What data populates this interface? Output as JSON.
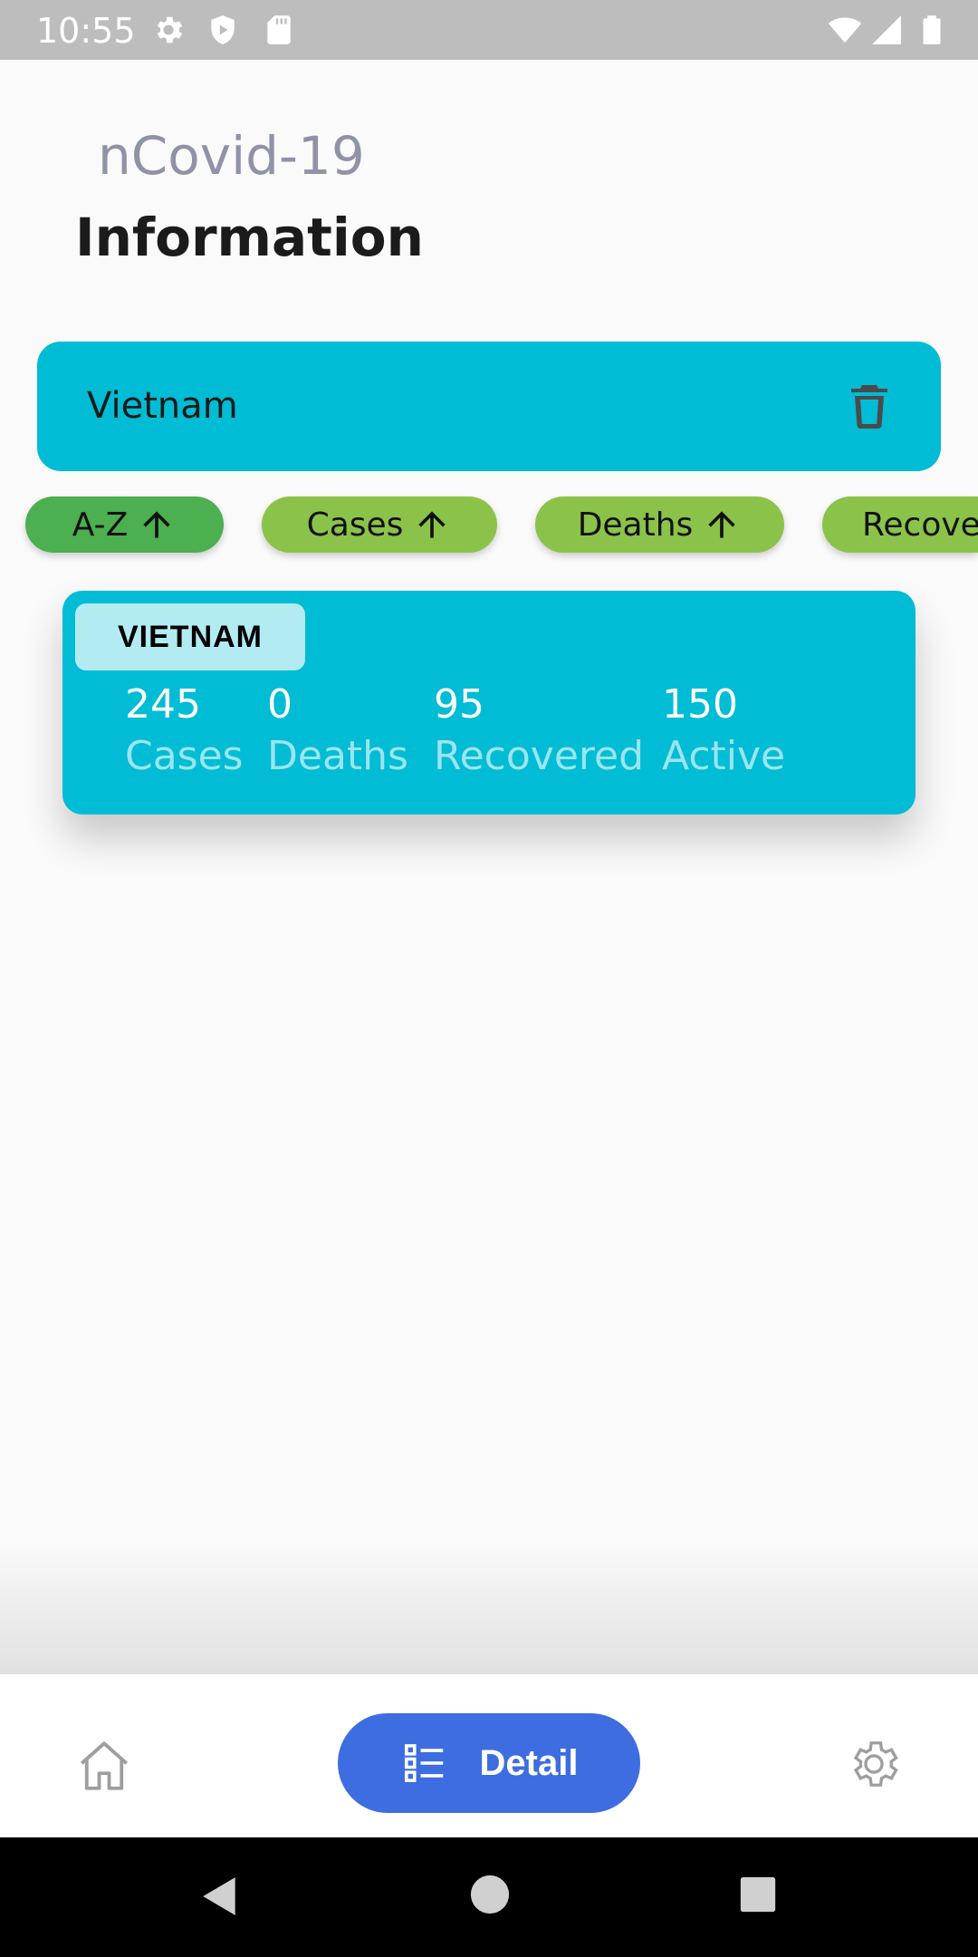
{
  "status_bar": {
    "time": "10:55",
    "icons": [
      "gear-icon",
      "shield-icon",
      "sd-card-icon",
      "wifi-icon",
      "signal-icon",
      "battery-icon"
    ]
  },
  "header": {
    "subtitle": "nCovid-19",
    "title": "Information"
  },
  "search": {
    "value": "Vietnam",
    "clear_icon": "delete-icon"
  },
  "sort_chips": [
    {
      "label": "A-Z",
      "icon": "arrow-up-icon",
      "active": true
    },
    {
      "label": "Cases",
      "icon": "arrow-up-icon",
      "active": false
    },
    {
      "label": "Deaths",
      "icon": "arrow-up-icon",
      "active": false
    },
    {
      "label": "Recove",
      "icon": "",
      "active": false
    }
  ],
  "country_card": {
    "country": "VIETNAM",
    "stats": [
      {
        "value": "245",
        "label": "Cases"
      },
      {
        "value": "0",
        "label": "Deaths"
      },
      {
        "value": "95",
        "label": "Recovered"
      },
      {
        "value": "150",
        "label": "Active"
      }
    ]
  },
  "bottom_nav": {
    "home_icon": "home-icon",
    "detail_label": "Detail",
    "detail_icon": "list-icon",
    "settings_icon": "gear-icon"
  },
  "system_nav": [
    "back-icon",
    "home-circle-icon",
    "recents-icon"
  ],
  "colors": {
    "accent_cyan": "#00bcd4",
    "chip_green": "#8bc34a",
    "chip_active_green": "#4caf50",
    "nav_blue": "#3d6de0"
  }
}
